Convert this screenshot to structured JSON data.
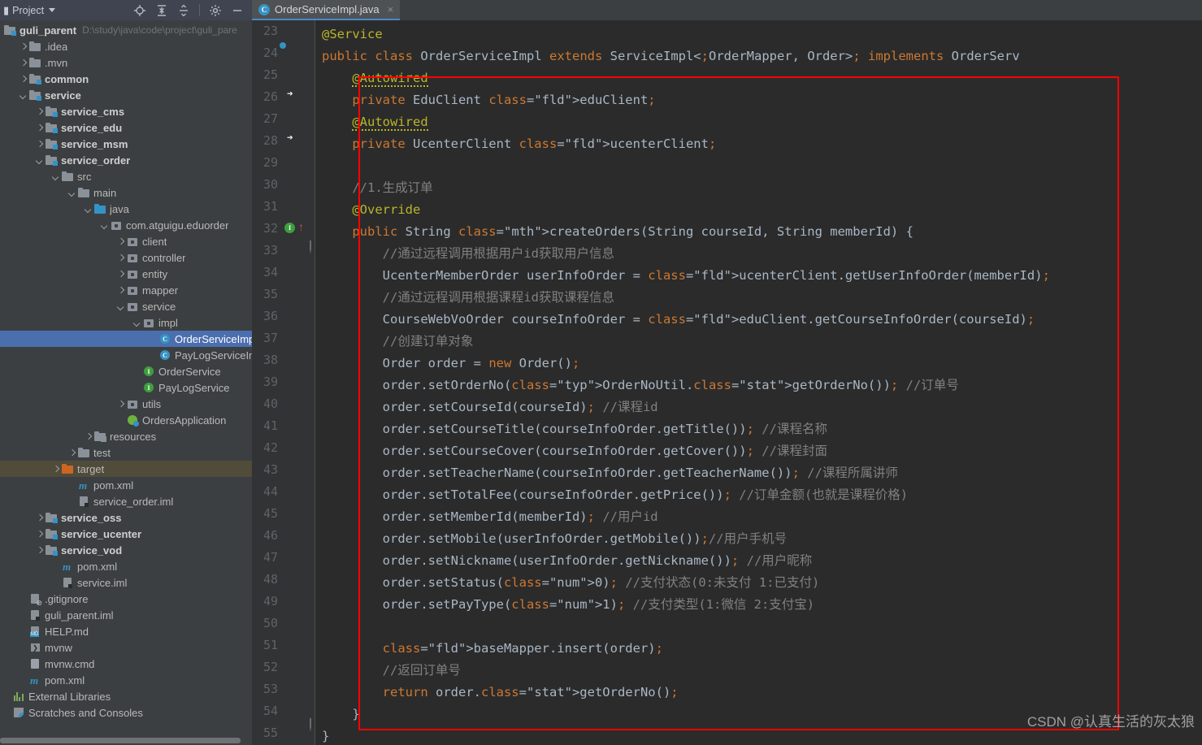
{
  "project_panel": {
    "title": "Project",
    "tools": [
      {
        "name": "locate-icon",
        "label": "Select Opened File"
      },
      {
        "name": "expand-all-icon",
        "label": "Expand All"
      },
      {
        "name": "collapse-all-icon",
        "label": "Collapse All"
      },
      {
        "name": "gear-icon",
        "label": "Settings"
      },
      {
        "name": "minimize-icon",
        "label": "Hide"
      }
    ],
    "root": {
      "label": "guli_parent",
      "path": "D:\\study\\java\\code\\project\\guli_pare"
    },
    "tree": [
      {
        "label": ".idea",
        "indent": 1,
        "arrow": "r",
        "icon": "folder",
        "bold": false
      },
      {
        "label": ".mvn",
        "indent": 1,
        "arrow": "r",
        "icon": "folder",
        "bold": false
      },
      {
        "label": "common",
        "indent": 1,
        "arrow": "r",
        "icon": "module",
        "bold": true
      },
      {
        "label": "service",
        "indent": 1,
        "arrow": "d",
        "icon": "module",
        "bold": true
      },
      {
        "label": "service_cms",
        "indent": 2,
        "arrow": "r",
        "icon": "module",
        "bold": true
      },
      {
        "label": "service_edu",
        "indent": 2,
        "arrow": "r",
        "icon": "module",
        "bold": true
      },
      {
        "label": "service_msm",
        "indent": 2,
        "arrow": "r",
        "icon": "module",
        "bold": true
      },
      {
        "label": "service_order",
        "indent": 2,
        "arrow": "d",
        "icon": "module",
        "bold": true
      },
      {
        "label": "src",
        "indent": 3,
        "arrow": "d",
        "icon": "folder",
        "bold": false
      },
      {
        "label": "main",
        "indent": 4,
        "arrow": "d",
        "icon": "folder",
        "bold": false
      },
      {
        "label": "java",
        "indent": 5,
        "arrow": "d",
        "icon": "sources-folder",
        "bold": false
      },
      {
        "label": "com.atguigu.eduorder",
        "indent": 6,
        "arrow": "d",
        "icon": "package",
        "bold": false
      },
      {
        "label": "client",
        "indent": 7,
        "arrow": "r",
        "icon": "package",
        "bold": false
      },
      {
        "label": "controller",
        "indent": 7,
        "arrow": "r",
        "icon": "package",
        "bold": false
      },
      {
        "label": "entity",
        "indent": 7,
        "arrow": "r",
        "icon": "package",
        "bold": false
      },
      {
        "label": "mapper",
        "indent": 7,
        "arrow": "r",
        "icon": "package",
        "bold": false
      },
      {
        "label": "service",
        "indent": 7,
        "arrow": "d",
        "icon": "package",
        "bold": false
      },
      {
        "label": "impl",
        "indent": 8,
        "arrow": "d",
        "icon": "package",
        "bold": false
      },
      {
        "label": "OrderServiceImpl",
        "indent": 9,
        "arrow": "",
        "icon": "class",
        "bold": false,
        "selected": true
      },
      {
        "label": "PayLogServiceImpl",
        "indent": 9,
        "arrow": "",
        "icon": "class",
        "bold": false
      },
      {
        "label": "OrderService",
        "indent": 8,
        "arrow": "",
        "icon": "interface",
        "bold": false
      },
      {
        "label": "PayLogService",
        "indent": 8,
        "arrow": "",
        "icon": "interface",
        "bold": false
      },
      {
        "label": "utils",
        "indent": 7,
        "arrow": "r",
        "icon": "package",
        "bold": false
      },
      {
        "label": "OrdersApplication",
        "indent": 7,
        "arrow": "",
        "icon": "spring-class",
        "bold": false
      },
      {
        "label": "resources",
        "indent": 5,
        "arrow": "r",
        "icon": "resources-folder",
        "bold": false
      },
      {
        "label": "test",
        "indent": 4,
        "arrow": "r",
        "icon": "folder",
        "bold": false
      },
      {
        "label": "target",
        "indent": 3,
        "arrow": "r",
        "icon": "target-folder",
        "bold": false,
        "highlight": true
      },
      {
        "label": "pom.xml",
        "indent": 4,
        "arrow": "",
        "icon": "maven",
        "bold": false
      },
      {
        "label": "service_order.iml",
        "indent": 4,
        "arrow": "",
        "icon": "iml",
        "bold": false
      },
      {
        "label": "service_oss",
        "indent": 2,
        "arrow": "r",
        "icon": "module",
        "bold": true
      },
      {
        "label": "service_ucenter",
        "indent": 2,
        "arrow": "r",
        "icon": "module",
        "bold": true
      },
      {
        "label": "service_vod",
        "indent": 2,
        "arrow": "r",
        "icon": "module",
        "bold": true
      },
      {
        "label": "pom.xml",
        "indent": 3,
        "arrow": "",
        "icon": "maven",
        "bold": false
      },
      {
        "label": "service.iml",
        "indent": 3,
        "arrow": "",
        "icon": "iml",
        "bold": false
      },
      {
        "label": ".gitignore",
        "indent": 1,
        "arrow": "",
        "icon": "gitignore",
        "bold": false
      },
      {
        "label": "guli_parent.iml",
        "indent": 1,
        "arrow": "",
        "icon": "iml",
        "bold": false
      },
      {
        "label": "HELP.md",
        "indent": 1,
        "arrow": "",
        "icon": "markdown",
        "bold": false
      },
      {
        "label": "mvnw",
        "indent": 1,
        "arrow": "",
        "icon": "shell",
        "bold": false
      },
      {
        "label": "mvnw.cmd",
        "indent": 1,
        "arrow": "",
        "icon": "cmd",
        "bold": false
      },
      {
        "label": "pom.xml",
        "indent": 1,
        "arrow": "",
        "icon": "maven",
        "bold": false
      },
      {
        "label": "External Libraries",
        "indent": 0,
        "arrow": "",
        "icon": "libraries",
        "bold": false
      },
      {
        "label": "Scratches and Consoles",
        "indent": 0,
        "arrow": "",
        "icon": "scratches",
        "bold": false
      }
    ]
  },
  "editor": {
    "tab": {
      "label": "OrderServiceImpl.java",
      "icon": "java-class-icon",
      "close": "×"
    },
    "first_line": 23,
    "last_line": 55,
    "line_numbers": [
      23,
      24,
      25,
      26,
      27,
      28,
      29,
      30,
      31,
      32,
      33,
      34,
      35,
      36,
      37,
      38,
      39,
      40,
      41,
      42,
      43,
      44,
      45,
      46,
      47,
      48,
      49,
      50,
      51,
      52,
      53,
      54,
      55
    ],
    "gutter_markers": [
      {
        "line": 24,
        "icon": "spring-bean-icon"
      },
      {
        "line": 26,
        "icon": "spring-autowired-icon"
      },
      {
        "line": 28,
        "icon": "spring-autowired-icon"
      },
      {
        "line": 32,
        "icon": "implementing-method-icon"
      }
    ],
    "highlight_box_color": "#ff0000",
    "watermark": "CSDN @认真生活的灰太狼",
    "code_lines": [
      "@Service",
      "public class OrderServiceImpl extends ServiceImpl<OrderMapper, Order> implements OrderServ",
      "    @Autowired",
      "    private EduClient eduClient;",
      "    @Autowired",
      "    private UcenterClient ucenterClient;",
      "",
      "    //1.生成订单",
      "    @Override",
      "    public String createOrders(String courseId, String memberId) {",
      "        //通过远程调用根据用户id获取用户信息",
      "        UcenterMemberOrder userInfoOrder = ucenterClient.getUserInfoOrder(memberId);",
      "        //通过远程调用根据课程id获取课程信息",
      "        CourseWebVoOrder courseInfoOrder = eduClient.getCourseInfoOrder(courseId);",
      "        //创建订单对象",
      "        Order order = new Order();",
      "        order.setOrderNo(OrderNoUtil.getOrderNo()); //订单号",
      "        order.setCourseId(courseId); //课程id",
      "        order.setCourseTitle(courseInfoOrder.getTitle()); //课程名称",
      "        order.setCourseCover(courseInfoOrder.getCover()); //课程封面",
      "        order.setTeacherName(courseInfoOrder.getTeacherName()); //课程所属讲师",
      "        order.setTotalFee(courseInfoOrder.getPrice()); //订单金额(也就是课程价格)",
      "        order.setMemberId(memberId); //用户id",
      "        order.setMobile(userInfoOrder.getMobile());//用户手机号",
      "        order.setNickname(userInfoOrder.getNickname()); //用户昵称",
      "        order.setStatus(0); //支付状态(0:未支付 1:已支付)",
      "        order.setPayType(1); //支付类型(1:微信 2:支付宝)",
      "",
      "        baseMapper.insert(order);",
      "        //返回订单号",
      "        return order.getOrderNo();",
      "    }",
      "}"
    ]
  },
  "colors": {
    "editor_bg": "#2b2b2b",
    "gutter_bg": "#313335",
    "panel_bg": "#3c3f41",
    "toolbar_bg": "#3f4450",
    "selection_blue": "#4b6eaf",
    "target_amber": "#514b3a",
    "annotation": "#bbb529",
    "keyword": "#cc7832",
    "method": "#ffc66d",
    "field": "#9876aa",
    "number": "#6897bb",
    "comment": "#808080",
    "text": "#a9b7c6",
    "accent_blue": "#3592c4",
    "spring_green": "#6db33f"
  }
}
